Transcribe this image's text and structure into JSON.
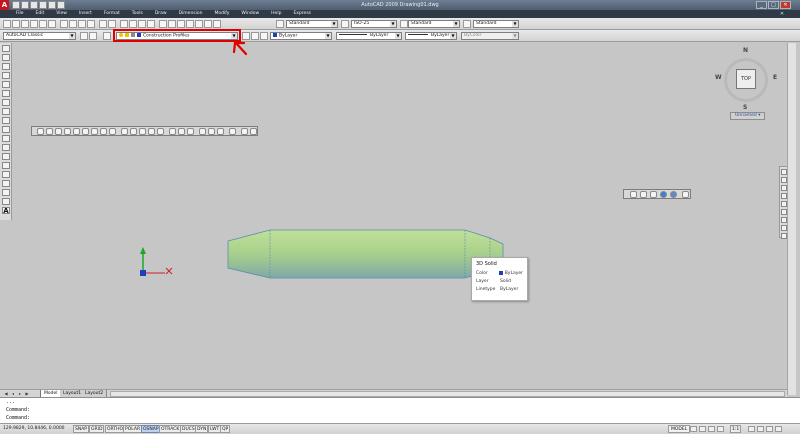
{
  "window": {
    "logo": "A",
    "title": "AutoCAD 2009 Drawing01.dwg",
    "minimize": "_",
    "maximize": "□",
    "close": "✕"
  },
  "menu": [
    "File",
    "Edit",
    "View",
    "Insert",
    "Format",
    "Tools",
    "Draw",
    "Dimension",
    "Modify",
    "Window",
    "Help",
    "Express"
  ],
  "toolbar1": {
    "text_style": "Standard",
    "dim_style": "ISO-25",
    "table_style": "Standard",
    "mleader_style": "Standard"
  },
  "toolbar2": {
    "workspace": "AutoCAD Classic",
    "layer": "Construction Profiles",
    "color": "ByLayer",
    "linetype": "ByLayer",
    "lineweight": "ByLayer",
    "plotstyle": "ByColor"
  },
  "viewcube": {
    "top": "TOP",
    "north": "N",
    "south": "S",
    "east": "E",
    "west": "W",
    "wcs": "Unnamed"
  },
  "tooltip": {
    "title": "3D Solid",
    "rows": [
      {
        "key": "Color",
        "value": "ByLayer"
      },
      {
        "key": "Layer",
        "value": "Solid"
      },
      {
        "key": "Linetype",
        "value": "ByLayer"
      }
    ]
  },
  "tabs": {
    "model": "Model",
    "layout1": "Layout1",
    "layout2": "Layout2"
  },
  "command": {
    "line1": "...",
    "line2": "Command:",
    "line3": "Command:"
  },
  "status": {
    "coords": "129.9829, 10.8446, 0.0000",
    "buttons": [
      {
        "label": "SNAP",
        "on": false
      },
      {
        "label": "GRID",
        "on": false
      },
      {
        "label": "ORTHO",
        "on": false
      },
      {
        "label": "POLAR",
        "on": false
      },
      {
        "label": "OSNAP",
        "on": true
      },
      {
        "label": "OTRACK",
        "on": false
      },
      {
        "label": "DUCS",
        "on": false
      },
      {
        "label": "DYN",
        "on": false
      },
      {
        "label": "LWT",
        "on": false
      },
      {
        "label": "QP",
        "on": false
      }
    ],
    "model": "MODEL",
    "scale": "1:1"
  },
  "colors": {
    "solid_light": "#b3d88c",
    "solid_dark": "#86b2a8",
    "annotation": "#e00000",
    "accent": "#2b4c99"
  }
}
